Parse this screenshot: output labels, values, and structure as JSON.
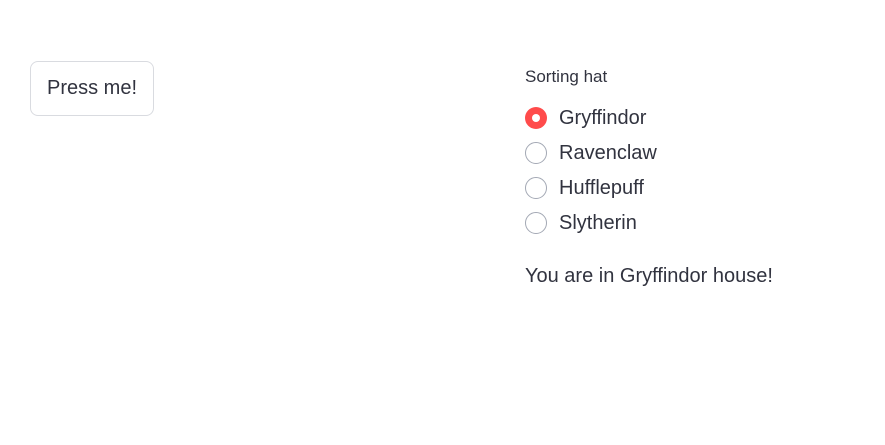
{
  "button": {
    "label": "Press me!"
  },
  "radio": {
    "label": "Sorting hat",
    "options": [
      "Gryffindor",
      "Ravenclaw",
      "Hufflepuff",
      "Slytherin"
    ],
    "selected_index": 0,
    "accent_color": "#ff4b4b"
  },
  "result": {
    "text": "You are in Gryffindor house!"
  }
}
